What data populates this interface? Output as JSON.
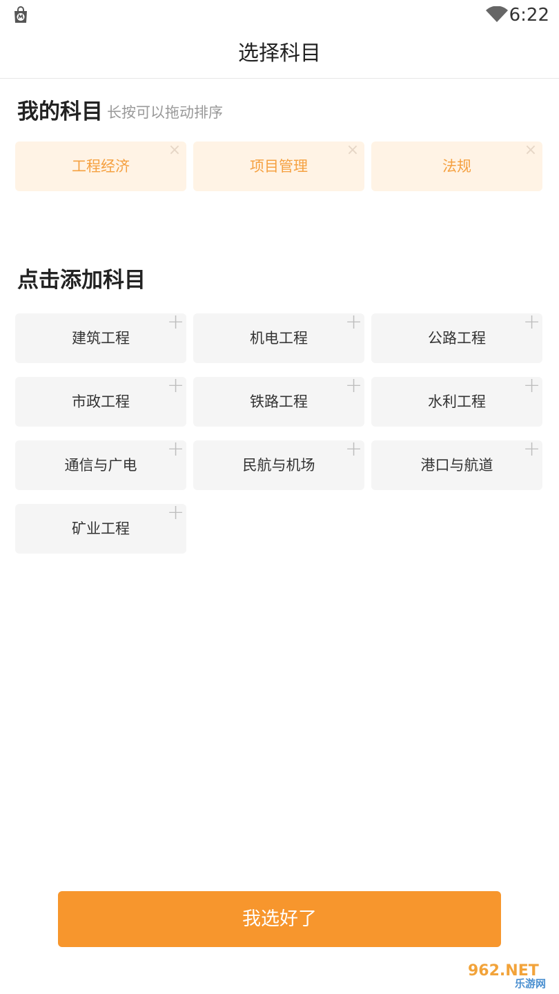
{
  "status_bar": {
    "time": "6:22",
    "icons": [
      "app-store-icon",
      "wifi-icon"
    ]
  },
  "header": {
    "title": "选择科目"
  },
  "my_subjects": {
    "title": "我的科目",
    "hint": "长按可以拖动排序",
    "items": [
      {
        "label": "工程经济",
        "action_icon": "×"
      },
      {
        "label": "项目管理",
        "action_icon": "×"
      },
      {
        "label": "法规",
        "action_icon": "×"
      }
    ]
  },
  "add_subjects": {
    "title": "点击添加科目",
    "items": [
      {
        "label": "建筑工程",
        "action_icon": "+"
      },
      {
        "label": "机电工程",
        "action_icon": "+"
      },
      {
        "label": "公路工程",
        "action_icon": "+"
      },
      {
        "label": "市政工程",
        "action_icon": "+"
      },
      {
        "label": "铁路工程",
        "action_icon": "+"
      },
      {
        "label": "水利工程",
        "action_icon": "+"
      },
      {
        "label": "通信与广电",
        "action_icon": "+"
      },
      {
        "label": "民航与机场",
        "action_icon": "+"
      },
      {
        "label": "港口与航道",
        "action_icon": "+"
      },
      {
        "label": "矿业工程",
        "action_icon": "+"
      }
    ]
  },
  "footer": {
    "confirm_label": "我选好了"
  },
  "watermark": {
    "text_top": "962.NET",
    "text_bottom": "乐游网"
  },
  "colors": {
    "accent": "#f7962d",
    "selected_chip_bg": "#fff3e5",
    "selected_chip_text": "#f5a040",
    "chip_bg": "#f5f5f5"
  }
}
